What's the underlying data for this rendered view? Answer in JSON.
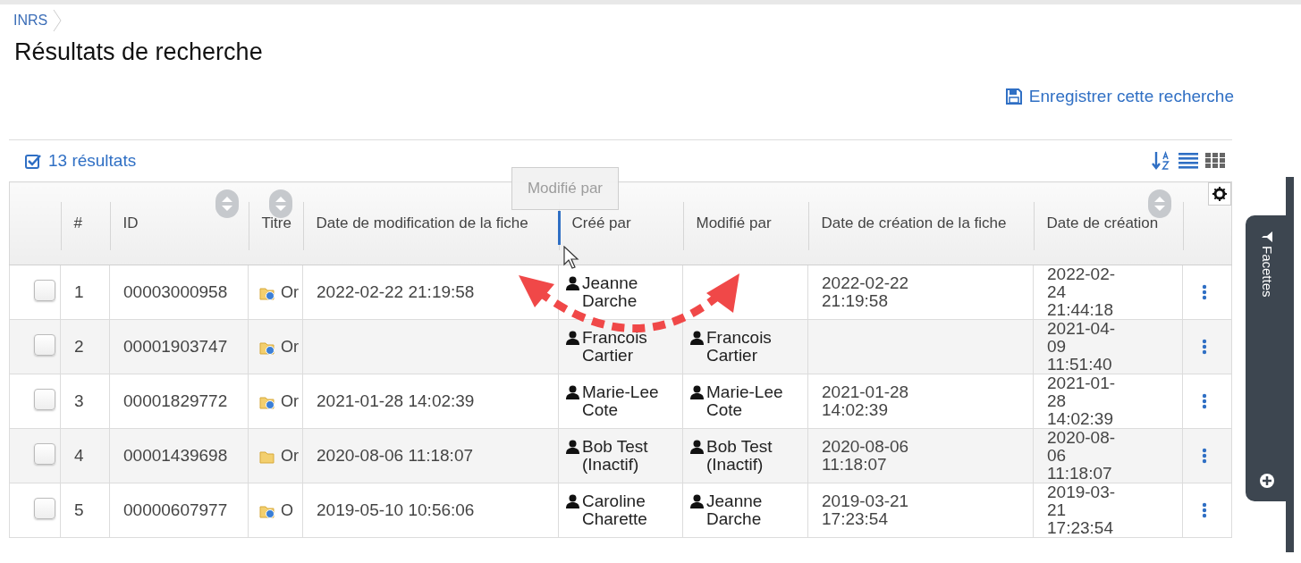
{
  "breadcrumb": [
    {
      "label": "INRS"
    }
  ],
  "title": "Résultats de recherche",
  "save_link": "Enregistrer cette recherche",
  "results_count": "13 résultats",
  "view_buttons": [
    {
      "kind": "sort"
    },
    {
      "kind": "list",
      "selected": true
    },
    {
      "kind": "grid",
      "selected": false
    }
  ],
  "table": {
    "columns": [
      {
        "kind": "select"
      },
      {
        "label": "#"
      },
      {
        "label": "ID",
        "sortable": true
      },
      {
        "label": "Titre",
        "sortable": true
      },
      {
        "label": "Date de modification de la fiche",
        "drop_target": true
      },
      {
        "label": "Créé par"
      },
      {
        "label": "Modifié par"
      },
      {
        "label": "Date de création de la fiche"
      },
      {
        "label": "Date de création",
        "sortable": true
      },
      {
        "kind": "settings"
      }
    ],
    "rows": [
      {
        "checked": false,
        "num": "1",
        "id": "00003000958",
        "kind": "web-folder",
        "title": "Or",
        "date_modification": "2022-02-22 21:19:58",
        "created_by": "Jeanne Darche",
        "date_creation_fiche": "2022-02-22 21:19:58",
        "date_creation": [
          "2022-02-",
          "24",
          "21:44:18"
        ]
      },
      {
        "checked": false,
        "num": "2",
        "id": "00001903747",
        "kind": "web-folder",
        "title": "Or",
        "created_by": "Francois Cartier",
        "modified_by": "Francois Cartier",
        "date_creation": [
          "2021-04-",
          "09",
          "11:51:40"
        ]
      },
      {
        "checked": false,
        "num": "3",
        "id": "00001829772",
        "kind": "web-folder",
        "title": "Or",
        "date_modification": "2021-01-28 14:02:39",
        "created_by": "Marie-Lee Cote",
        "modified_by": "Marie-Lee Cote",
        "date_creation_fiche": "2021-01-28 14:02:39",
        "date_creation": [
          "2021-01-",
          "28",
          "14:02:39"
        ]
      },
      {
        "checked": false,
        "num": "4",
        "id": "00001439698",
        "kind": "folder",
        "title": "Or",
        "date_modification": "2020-08-06 11:18:07",
        "created_by": "Bob Test (Inactif)",
        "modified_by": "Bob Test (Inactif)",
        "date_creation_fiche": "2020-08-06 11:18:07",
        "date_creation": [
          "2020-08-",
          "06",
          "11:18:07"
        ]
      },
      {
        "checked": false,
        "num": "5",
        "id": "00000607977",
        "kind": "web-folder",
        "title": "O",
        "date_modification": "2019-05-10 10:56:06",
        "created_by": "Caroline Charette",
        "modified_by": "Jeanne Darche",
        "date_creation_fiche": "2019-03-21 17:23:54",
        "date_creation": [
          "2019-03-",
          "21",
          "17:23:54"
        ]
      }
    ]
  },
  "drag_ghost": {
    "label": "Modifié par"
  },
  "facets_tab": {
    "label": "Facettes"
  }
}
